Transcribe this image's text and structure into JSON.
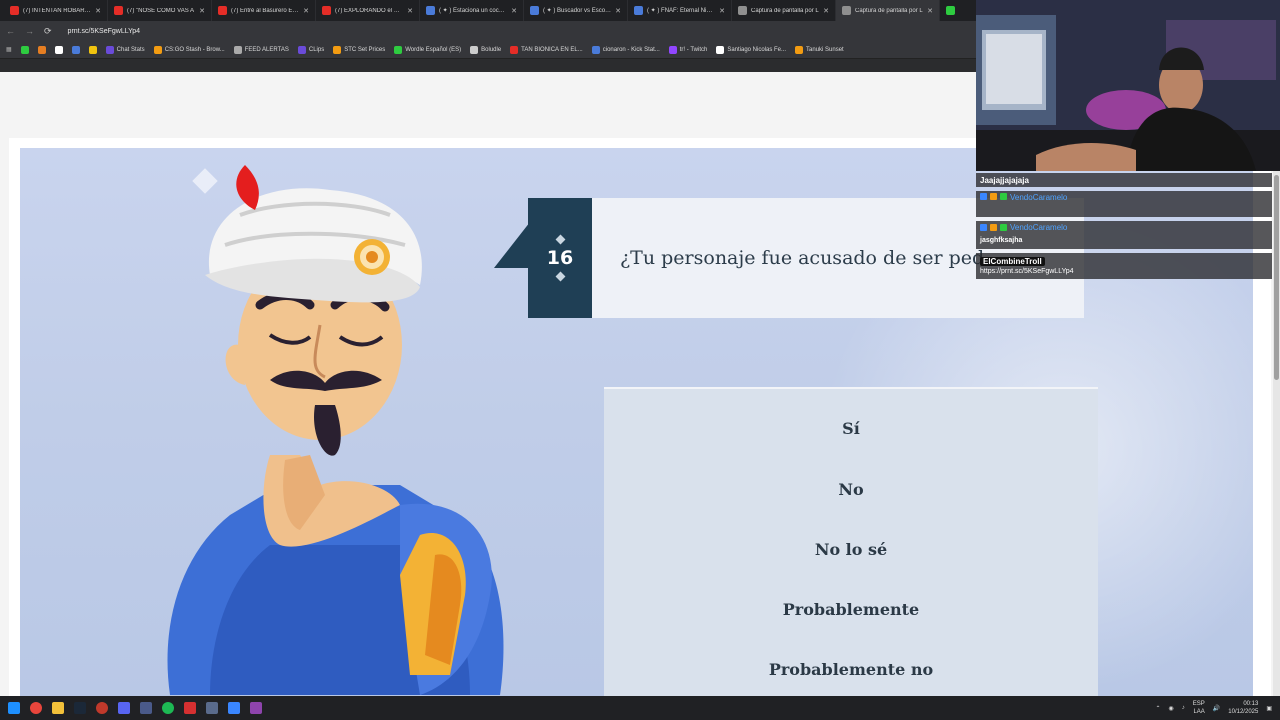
{
  "browser": {
    "tabs": [
      {
        "label": "(7) INTENTAN ROBARME",
        "fav": "#e52d27"
      },
      {
        "label": "(7) \"NOSE COMO VAS A",
        "fav": "#e52d27"
      },
      {
        "label": "(7) Entré al Basurero Electr",
        "fav": "#e52d27"
      },
      {
        "label": "(7) EXPLORANDO el CERR",
        "fav": "#e52d27"
      },
      {
        "label": "( ✦ ) Estaciona un cochecit",
        "fav": "#4a7bd9"
      },
      {
        "label": "( ✦ ) Buscador vs Escondi",
        "fav": "#4a7bd9"
      },
      {
        "label": "( ✦ ) FNAF: Eternal Nights",
        "fav": "#4a7bd9"
      },
      {
        "label": "Captura de pantalla por L",
        "fav": "#8f8f8f"
      },
      {
        "label": "Captura de pantalla por L",
        "fav": "#8f8f8f"
      }
    ],
    "url": "prnt.sc/5KSeFgwLLYp4",
    "bookmarks": [
      {
        "label": "",
        "color": "#2ecc40"
      },
      {
        "label": "",
        "color": "#e67e22"
      },
      {
        "label": "",
        "color": "#ffffff"
      },
      {
        "label": "",
        "color": "#4a7bd9"
      },
      {
        "label": "",
        "color": "#f1c40f"
      },
      {
        "label": "Chat Stats",
        "color": "#6a4bd9"
      },
      {
        "label": "CS:GO Stash - Brow...",
        "color": "#f39c12"
      },
      {
        "label": "FEED ALERTAS",
        "color": "#aaaaaa"
      },
      {
        "label": "CLips",
        "color": "#6a4bd9"
      },
      {
        "label": "STC Set Prices",
        "color": "#f39c12"
      },
      {
        "label": "Wordle Español (ES)",
        "color": "#2ecc40"
      },
      {
        "label": "Boludle",
        "color": "#cccccc"
      },
      {
        "label": "TAN BIONICA EN EL...",
        "color": "#e52d27"
      },
      {
        "label": "cionaron - Kick Stat...",
        "color": "#4a7bd9"
      },
      {
        "label": "tr! - Twitch",
        "color": "#9146ff"
      },
      {
        "label": "Santiago Nicolas Fe...",
        "color": "#ffffff"
      },
      {
        "label": "Tanuki Sunset",
        "color": "#f39c12"
      }
    ]
  },
  "game": {
    "question_number": "16",
    "question_text": "¿Tu personaje fue acusado de ser ped",
    "answers": [
      "Sí",
      "No",
      "No lo sé",
      "Probablemente",
      "Probablemente no"
    ]
  },
  "chat": {
    "messages": [
      {
        "user": "",
        "text": "Jaajajjajajaja"
      },
      {
        "user": "VendoCaramelo",
        "text": ""
      },
      {
        "user": "VendoCaramelo",
        "text": "jasghfksajha"
      },
      {
        "user": "ElCombineTroll",
        "text": "https://prnt.sc/5KSeFgwLLYp4"
      }
    ]
  },
  "taskbar": {
    "lang": "ESP",
    "lang_sub": "LAA",
    "time": "00:13",
    "date": "10/12/2025"
  }
}
